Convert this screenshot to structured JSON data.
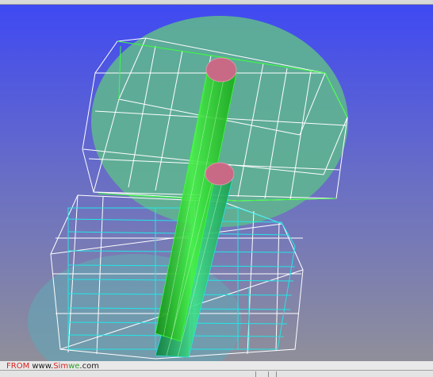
{
  "watermark": {
    "from": "FROM",
    "www": " www.",
    "sim": "Sim",
    "we": "we",
    "com": ".com"
  },
  "colors": {
    "background_top": "#3f49f2",
    "background_bottom": "#8f8f9a",
    "large_disk_fill": "#5fb590",
    "lower_disk_fill": "#6aa0b2",
    "wireframe": "#ffffff",
    "edge_green": "#39ff39",
    "edge_cyan": "#22e6e6",
    "cylinder_green": "#2ed62e",
    "cap_pink": "#c86a86"
  },
  "icons": {
    "viewport": "3d-viewport",
    "statusbar": "status-bar"
  }
}
